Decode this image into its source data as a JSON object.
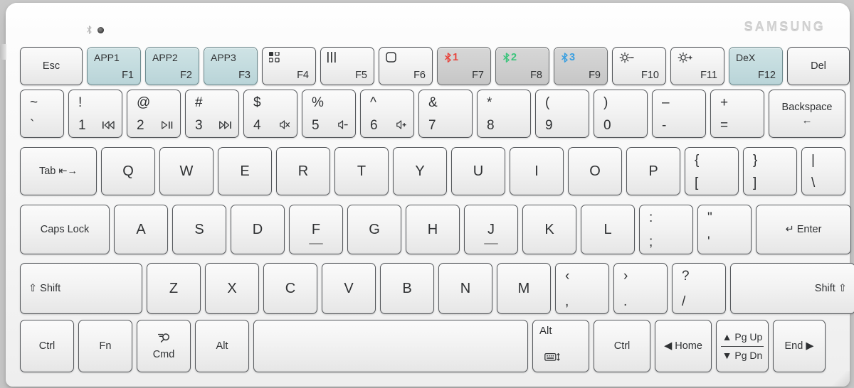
{
  "brand": "SAMSUNG",
  "indicators": {
    "bluetooth_icon": "bluetooth-icon",
    "led": "status-led"
  },
  "colors": {
    "body": "#f6f6f6",
    "key_face": "#f2f2f2",
    "key_teal": "#c4dcdf",
    "key_grey": "#cfcfcf",
    "text": "#2f3133",
    "bt1_red": "#e8443c",
    "bt2_green": "#3cc47c",
    "bt3_blue": "#3a9fe0",
    "brand_text": "#d2d2d2"
  },
  "rows": [
    {
      "name": "function-row",
      "keys": [
        {
          "name": "esc",
          "center": "Esc",
          "size": "sm"
        },
        {
          "name": "f1",
          "top": "APP1",
          "sub": "F1",
          "tone": "teal"
        },
        {
          "name": "f2",
          "top": "APP2",
          "sub": "F2",
          "tone": "teal"
        },
        {
          "name": "f3",
          "top": "APP3",
          "sub": "F3",
          "tone": "teal"
        },
        {
          "name": "f4",
          "icon": "app-grid-icon",
          "sub": "F4"
        },
        {
          "name": "f5",
          "icon": "task-bars-icon",
          "sub": "F5"
        },
        {
          "name": "f6",
          "icon": "rounded-square-icon",
          "sub": "F6"
        },
        {
          "name": "f7",
          "icon": "bluetooth-1-icon",
          "bt": "1",
          "btcolor": "#e8443c",
          "sub": "F7",
          "tone": "grey"
        },
        {
          "name": "f8",
          "icon": "bluetooth-2-icon",
          "bt": "2",
          "btcolor": "#3cc47c",
          "sub": "F8",
          "tone": "grey"
        },
        {
          "name": "f9",
          "icon": "bluetooth-3-icon",
          "bt": "3",
          "btcolor": "#3a9fe0",
          "sub": "F9",
          "tone": "grey"
        },
        {
          "name": "f10",
          "icon": "brightness-down-icon",
          "sub": "F10"
        },
        {
          "name": "f11",
          "icon": "brightness-up-icon",
          "sub": "F11"
        },
        {
          "name": "f12",
          "top": "DeX",
          "sub": "F12",
          "tone": "teal"
        },
        {
          "name": "del",
          "center": "Del",
          "size": "sm"
        }
      ]
    },
    {
      "name": "number-row",
      "keys": [
        {
          "name": "backtick",
          "upper": "~",
          "lower": "`"
        },
        {
          "name": "digit-1",
          "upper": "!",
          "lower": "1",
          "media": "prev-track-icon"
        },
        {
          "name": "digit-2",
          "upper": "@",
          "lower": "2",
          "media": "play-pause-icon"
        },
        {
          "name": "digit-3",
          "upper": "#",
          "lower": "3",
          "media": "next-track-icon"
        },
        {
          "name": "digit-4",
          "upper": "$",
          "lower": "4",
          "media": "mute-icon"
        },
        {
          "name": "digit-5",
          "upper": "%",
          "lower": "5",
          "media": "volume-down-icon"
        },
        {
          "name": "digit-6",
          "upper": "^",
          "lower": "6",
          "media": "volume-up-icon"
        },
        {
          "name": "digit-7",
          "upper": "&",
          "lower": "7"
        },
        {
          "name": "digit-8",
          "upper": "*",
          "lower": "8"
        },
        {
          "name": "digit-9",
          "upper": "(",
          "lower": "9"
        },
        {
          "name": "digit-0",
          "upper": ")",
          "lower": "0"
        },
        {
          "name": "minus",
          "upper": "–",
          "lower": "-"
        },
        {
          "name": "equal",
          "upper": "+",
          "lower": "="
        },
        {
          "name": "backspace",
          "stack_top": "Backspace",
          "stack_bottom": "←"
        }
      ]
    },
    {
      "name": "tab-row",
      "keys": [
        {
          "name": "tab",
          "center": "Tab ⇤→",
          "size": "sm"
        },
        {
          "name": "q",
          "center": "Q"
        },
        {
          "name": "w",
          "center": "W"
        },
        {
          "name": "e",
          "center": "E"
        },
        {
          "name": "r",
          "center": "R"
        },
        {
          "name": "t",
          "center": "T"
        },
        {
          "name": "y",
          "center": "Y"
        },
        {
          "name": "u",
          "center": "U"
        },
        {
          "name": "i",
          "center": "I"
        },
        {
          "name": "o",
          "center": "O"
        },
        {
          "name": "p",
          "center": "P"
        },
        {
          "name": "bracket-left",
          "upper": "{",
          "lower": "["
        },
        {
          "name": "bracket-right",
          "upper": "}",
          "lower": "]"
        },
        {
          "name": "backslash",
          "upper": "|",
          "lower": "\\"
        }
      ]
    },
    {
      "name": "home-row",
      "keys": [
        {
          "name": "caps-lock",
          "center": "Caps Lock",
          "size": "sm"
        },
        {
          "name": "a",
          "center": "A"
        },
        {
          "name": "s",
          "center": "S"
        },
        {
          "name": "d",
          "center": "D"
        },
        {
          "name": "f",
          "center": "F",
          "homing": true
        },
        {
          "name": "g",
          "center": "G"
        },
        {
          "name": "h",
          "center": "H"
        },
        {
          "name": "j",
          "center": "J",
          "homing": true
        },
        {
          "name": "k",
          "center": "K"
        },
        {
          "name": "l",
          "center": "L"
        },
        {
          "name": "semicolon",
          "upper": ":",
          "lower": ";"
        },
        {
          "name": "quote",
          "upper": "\"",
          "lower": "'"
        },
        {
          "name": "enter",
          "center": "↵ Enter",
          "size": "sm"
        }
      ]
    },
    {
      "name": "shift-row",
      "keys": [
        {
          "name": "shift-left",
          "center": "⇧ Shift",
          "size": "sm",
          "align": "left"
        },
        {
          "name": "z",
          "center": "Z"
        },
        {
          "name": "x",
          "center": "X"
        },
        {
          "name": "c",
          "center": "C"
        },
        {
          "name": "v",
          "center": "V"
        },
        {
          "name": "b",
          "center": "B"
        },
        {
          "name": "n",
          "center": "N"
        },
        {
          "name": "m",
          "center": "M"
        },
        {
          "name": "comma",
          "upper": "‹",
          "lower": ","
        },
        {
          "name": "period",
          "upper": "›",
          "lower": "."
        },
        {
          "name": "slash",
          "upper": "?",
          "lower": "/"
        },
        {
          "name": "shift-right",
          "center": "Shift ⇧",
          "size": "sm",
          "align": "right"
        }
      ]
    },
    {
      "name": "bottom-row",
      "keys": [
        {
          "name": "ctrl-left",
          "center": "Ctrl",
          "size": "sm"
        },
        {
          "name": "fn",
          "center": "Fn",
          "size": "sm"
        },
        {
          "name": "cmd",
          "icon": "search-cmd-icon",
          "stack_txt": "Cmd"
        },
        {
          "name": "alt-left",
          "center": "Alt",
          "size": "sm"
        },
        {
          "name": "space",
          "center": ""
        },
        {
          "name": "alt-right",
          "center": "Alt",
          "size": "sm",
          "align": "left-top",
          "sub_icon": "keyboard-toggle-icon"
        },
        {
          "name": "ctrl-right",
          "center": "Ctrl",
          "size": "sm"
        },
        {
          "name": "home",
          "center": "◀ Home",
          "size": "sm"
        },
        {
          "name": "pgup-pgdn",
          "two_top": "▲ Pg Up",
          "two_bottom": "▼ Pg Dn"
        },
        {
          "name": "end",
          "center": "End ▶",
          "size": "sm"
        }
      ]
    }
  ]
}
